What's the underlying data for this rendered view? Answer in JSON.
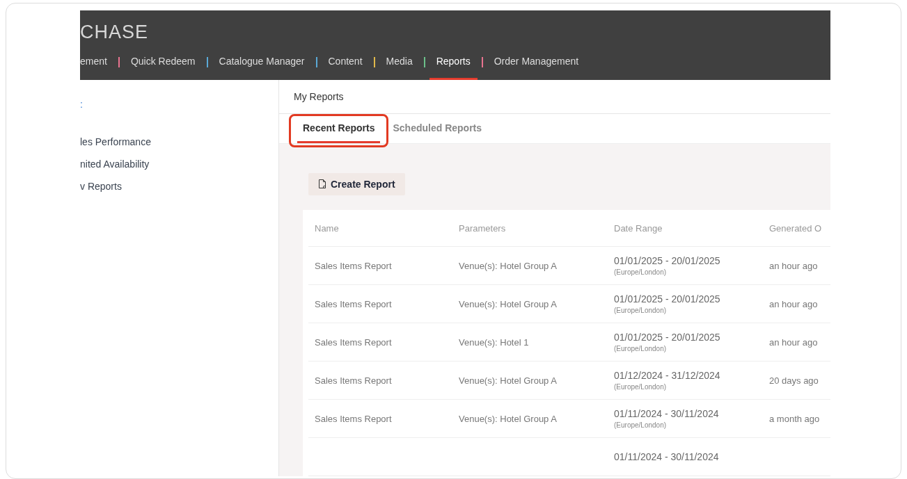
{
  "header": {
    "logo": "CHASE",
    "nav": [
      {
        "label": "ement",
        "selected": false,
        "color": "#e8738f"
      },
      {
        "label": "Quick Redeem",
        "selected": false,
        "color": "#5aa9d6"
      },
      {
        "label": "Catalogue Manager",
        "selected": false,
        "color": "#5aa9d6"
      },
      {
        "label": "Content",
        "selected": false,
        "color": "#e0b84a"
      },
      {
        "label": "Media",
        "selected": false,
        "color": "#6cc08a"
      },
      {
        "label": "Reports",
        "selected": true,
        "color": "#e8738f"
      },
      {
        "label": "Order Management",
        "selected": false
      }
    ]
  },
  "sidebar": {
    "heading": ":",
    "items": [
      {
        "label": "les Performance"
      },
      {
        "label": "nited Availability"
      },
      {
        "label": "v Reports"
      }
    ]
  },
  "page_title": "My Reports",
  "tabs": [
    {
      "label": "Recent Reports",
      "selected": true,
      "highlighted": true
    },
    {
      "label": "Scheduled Reports",
      "selected": false,
      "highlighted": false
    }
  ],
  "create_button": "Create Report",
  "table": {
    "columns": [
      "Name",
      "Parameters",
      "Date Range",
      "Generated O"
    ],
    "rows": [
      {
        "name": "Sales Items Report",
        "parameters": "Venue(s): Hotel Group A",
        "date_range": "01/01/2025 - 20/01/2025",
        "timezone": "(Europe/London)",
        "generated": "an hour ago"
      },
      {
        "name": "Sales Items Report",
        "parameters": "Venue(s): Hotel Group A",
        "date_range": "01/01/2025 - 20/01/2025",
        "timezone": "(Europe/London)",
        "generated": "an hour ago"
      },
      {
        "name": "Sales Items Report",
        "parameters": "Venue(s): Hotel 1",
        "date_range": "01/01/2025 - 20/01/2025",
        "timezone": "(Europe/London)",
        "generated": "an hour ago"
      },
      {
        "name": "Sales Items Report",
        "parameters": "Venue(s): Hotel Group A",
        "date_range": "01/12/2024 - 31/12/2024",
        "timezone": "(Europe/London)",
        "generated": "20 days ago"
      },
      {
        "name": "Sales Items Report",
        "parameters": "Venue(s): Hotel Group A",
        "date_range": "01/11/2024 - 30/11/2024",
        "timezone": "(Europe/London)",
        "generated": "a month ago"
      },
      {
        "date_range": "01/11/2024 - 30/11/2024"
      }
    ]
  }
}
